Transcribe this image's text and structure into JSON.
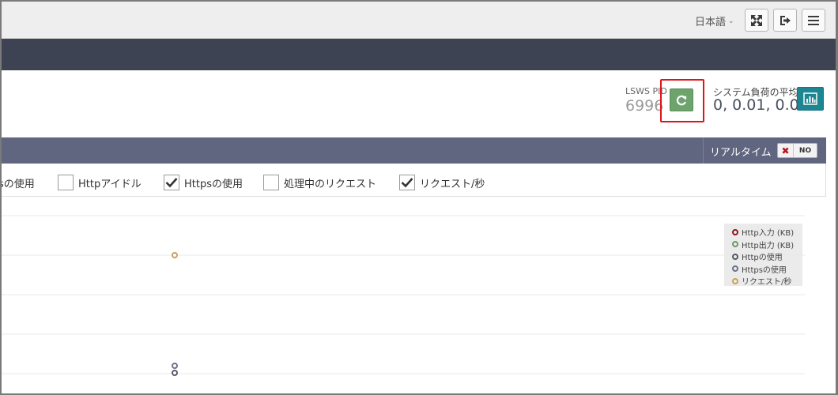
{
  "topbar": {
    "language": "日本語",
    "icons": [
      "expand-icon",
      "logout-icon",
      "menu-icon"
    ]
  },
  "status": {
    "pid_label": "LSWS PID",
    "pid_value": "6996",
    "load_label": "システム負荷の平均",
    "load_value": "0, 0.01, 0.05"
  },
  "panel": {
    "realtime_label": "リアルタイム",
    "realtime_toggle": "NO",
    "checkboxes": [
      {
        "label": "sの使用",
        "checked": false
      },
      {
        "label": "Httpアイドル",
        "checked": false
      },
      {
        "label": "Httpsの使用",
        "checked": true
      },
      {
        "label": "処理中のリクエスト",
        "checked": false
      },
      {
        "label": "リクエスト/秒",
        "checked": true
      }
    ]
  },
  "legend": [
    {
      "label": "Http入力 (KB)",
      "color": "#8b1a1a"
    },
    {
      "label": "Http出力 (KB)",
      "color": "#6a9a6a"
    },
    {
      "label": "Httpの使用",
      "color": "#555a66"
    },
    {
      "label": "Httpsの使用",
      "color": "#6a7388"
    },
    {
      "label": "リクエスト/秒",
      "color": "#c8a25a"
    }
  ],
  "colors": {
    "accent_restart": "#6da36d",
    "accent_chart_button": "#1d8693",
    "highlight": "#e0141a",
    "header_dark": "#3d4353",
    "panel_header": "#606580"
  }
}
